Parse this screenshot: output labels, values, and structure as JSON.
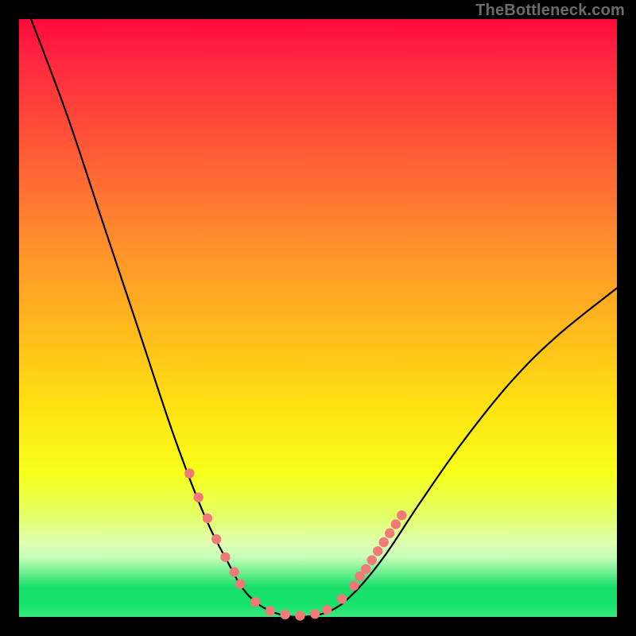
{
  "watermark": "TheBottleneck.com",
  "chart_data": {
    "type": "line",
    "title": "",
    "xlabel": "",
    "ylabel": "",
    "xlim": [
      0,
      100
    ],
    "ylim": [
      0,
      100
    ],
    "grid": false,
    "legend": false,
    "curve": {
      "name": "bottleneck-curve",
      "points": [
        {
          "x": 2,
          "y": 100
        },
        {
          "x": 8,
          "y": 84
        },
        {
          "x": 14,
          "y": 66
        },
        {
          "x": 20,
          "y": 48
        },
        {
          "x": 26,
          "y": 30
        },
        {
          "x": 31,
          "y": 17
        },
        {
          "x": 35,
          "y": 9
        },
        {
          "x": 38,
          "y": 4
        },
        {
          "x": 42,
          "y": 1
        },
        {
          "x": 47,
          "y": 0
        },
        {
          "x": 52,
          "y": 1
        },
        {
          "x": 56,
          "y": 4
        },
        {
          "x": 61,
          "y": 10
        },
        {
          "x": 67,
          "y": 19
        },
        {
          "x": 74,
          "y": 29
        },
        {
          "x": 82,
          "y": 39
        },
        {
          "x": 90,
          "y": 47
        },
        {
          "x": 100,
          "y": 55
        }
      ]
    },
    "markers": {
      "name": "data-points",
      "color": "#f07a78",
      "points": [
        {
          "x": 28.5,
          "y": 24
        },
        {
          "x": 30.0,
          "y": 20
        },
        {
          "x": 31.5,
          "y": 16.5
        },
        {
          "x": 33.0,
          "y": 13
        },
        {
          "x": 34.5,
          "y": 10
        },
        {
          "x": 36.0,
          "y": 7.5
        },
        {
          "x": 37.0,
          "y": 5.5
        },
        {
          "x": 39.5,
          "y": 2.5
        },
        {
          "x": 42.0,
          "y": 1.0
        },
        {
          "x": 44.5,
          "y": 0.4
        },
        {
          "x": 47.0,
          "y": 0.2
        },
        {
          "x": 49.5,
          "y": 0.5
        },
        {
          "x": 51.5,
          "y": 1.2
        },
        {
          "x": 54.0,
          "y": 3.0
        },
        {
          "x": 56.0,
          "y": 5.2
        },
        {
          "x": 57.0,
          "y": 6.8
        },
        {
          "x": 58.0,
          "y": 8.0
        },
        {
          "x": 59.0,
          "y": 9.5
        },
        {
          "x": 60.0,
          "y": 11.0
        },
        {
          "x": 61.0,
          "y": 12.5
        },
        {
          "x": 62.0,
          "y": 14.0
        },
        {
          "x": 63.0,
          "y": 15.5
        },
        {
          "x": 64.0,
          "y": 17.0
        }
      ]
    }
  }
}
